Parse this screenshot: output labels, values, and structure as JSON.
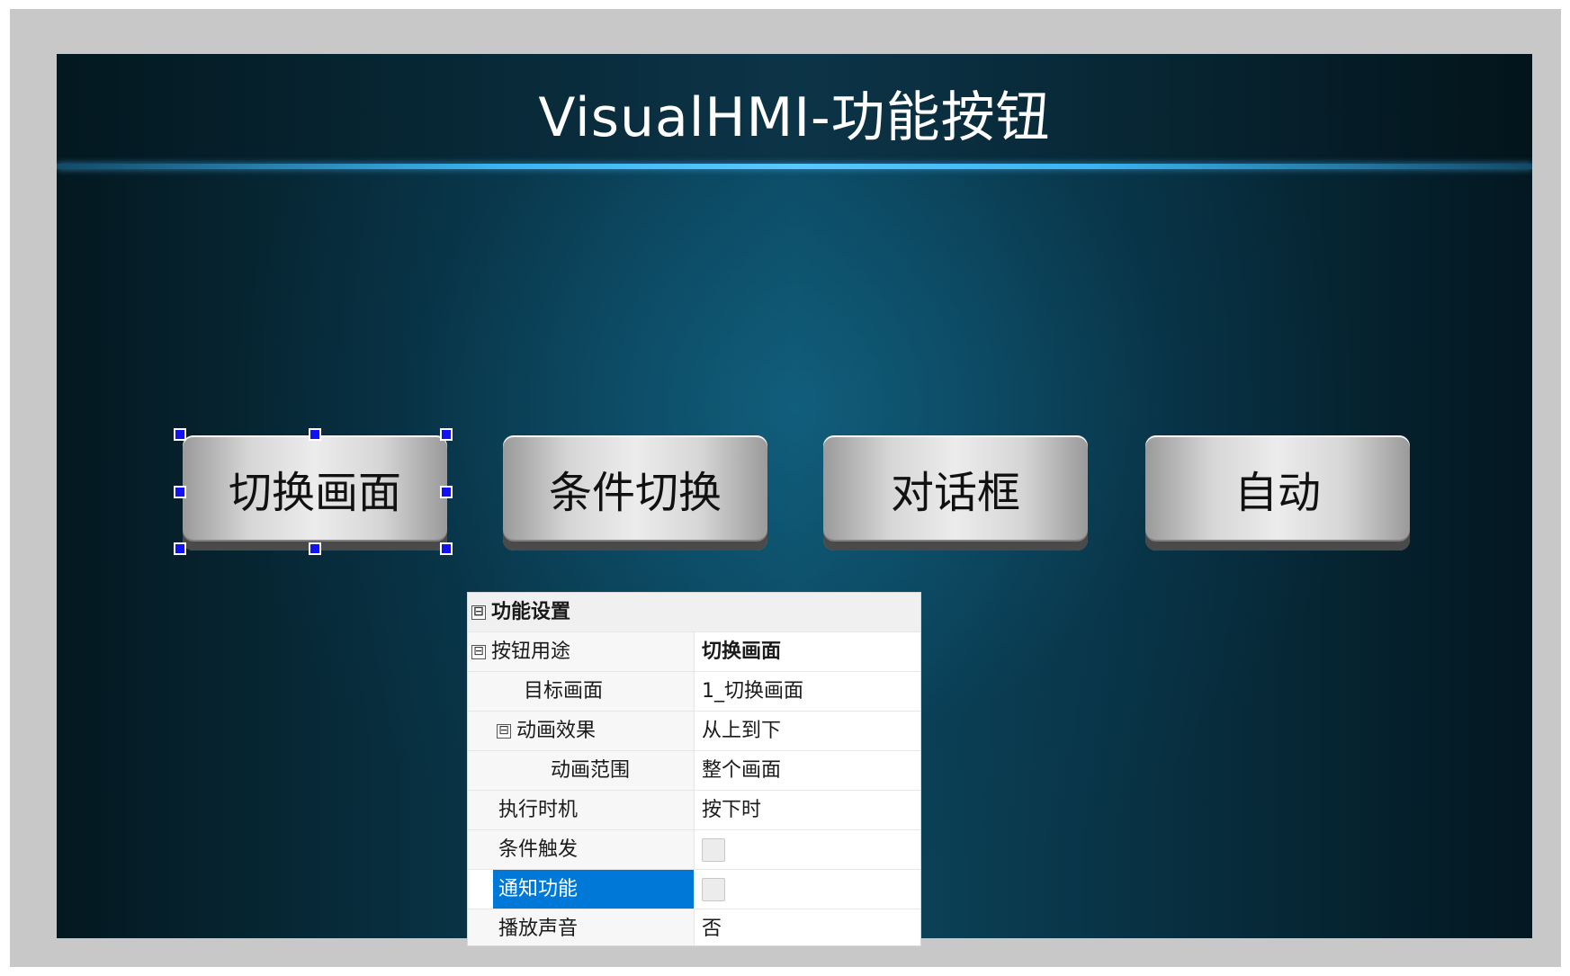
{
  "hmi": {
    "title": "VisualHMI-功能按钮",
    "buttons": [
      {
        "label": "切换画面",
        "selected": true
      },
      {
        "label": "条件切换",
        "selected": false
      },
      {
        "label": "对话框",
        "selected": false
      },
      {
        "label": "自动",
        "selected": false
      }
    ]
  },
  "property_panel": {
    "category_title": "功能设置",
    "rows": {
      "button_usage": {
        "name": "按钮用途",
        "value": "切换画面"
      },
      "target_screen": {
        "name": "目标画面",
        "value": "1_切换画面"
      },
      "animation_effect": {
        "name": "动画效果",
        "value": "从上到下"
      },
      "animation_range": {
        "name": "动画范围",
        "value": "整个画面"
      },
      "execute_timing": {
        "name": "执行时机",
        "value": "按下时"
      },
      "condition_trigger": {
        "name": "条件触发",
        "checked": false
      },
      "notify_function": {
        "name": "通知功能",
        "checked": false
      },
      "play_sound": {
        "name": "播放声音",
        "value": "否"
      }
    },
    "collapse_glyph": "⊟"
  }
}
